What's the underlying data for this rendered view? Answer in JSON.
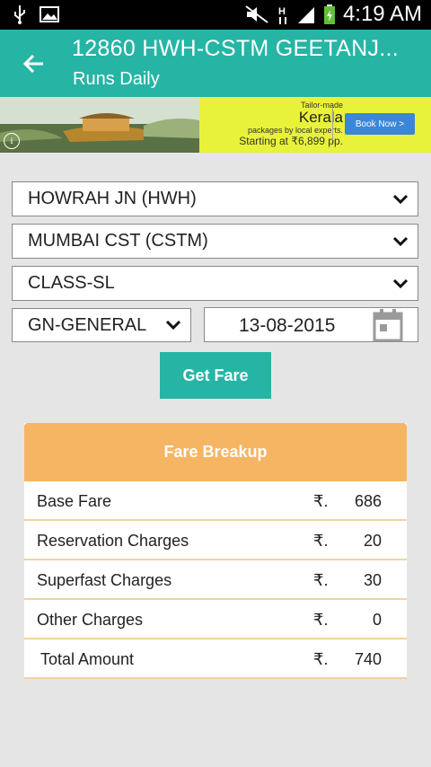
{
  "status_bar": {
    "time": "4:19 AM",
    "icons": [
      "usb-icon",
      "image-icon",
      "mute-icon",
      "data-h-icon",
      "signal-icon",
      "battery-icon"
    ]
  },
  "app_bar": {
    "title": "12860 HWH-CSTM GEETANJ...",
    "subtitle": "Runs Daily",
    "back_icon": "arrow-left-icon"
  },
  "ad": {
    "small_top": "Tailor-made",
    "headline": "Kerala",
    "small_mid": "packages by local experts.",
    "price_line": "Starting at ₹6,899 pp.",
    "button": "Book Now >",
    "info": "i"
  },
  "form": {
    "from_station": "HOWRAH JN (HWH)",
    "to_station": "MUMBAI CST (CSTM)",
    "travel_class": "CLASS-SL",
    "quota": "GN-GENERAL",
    "date": "13-08-2015",
    "submit": "Get Fare"
  },
  "fare": {
    "header": "Fare Breakup",
    "rows": [
      {
        "label": "Base Fare",
        "currency": "₹.",
        "amount": "686"
      },
      {
        "label": "Reservation Charges",
        "currency": "₹.",
        "amount": "20"
      },
      {
        "label": "Superfast Charges",
        "currency": "₹.",
        "amount": "30"
      },
      {
        "label": "Other Charges",
        "currency": "₹.",
        "amount": "0"
      },
      {
        "label": " Total Amount",
        "currency": "₹.",
        "amount": "740"
      }
    ]
  },
  "colors": {
    "accent": "#26b5a5",
    "card_header": "#f6b562",
    "background": "#e5e5e5"
  }
}
